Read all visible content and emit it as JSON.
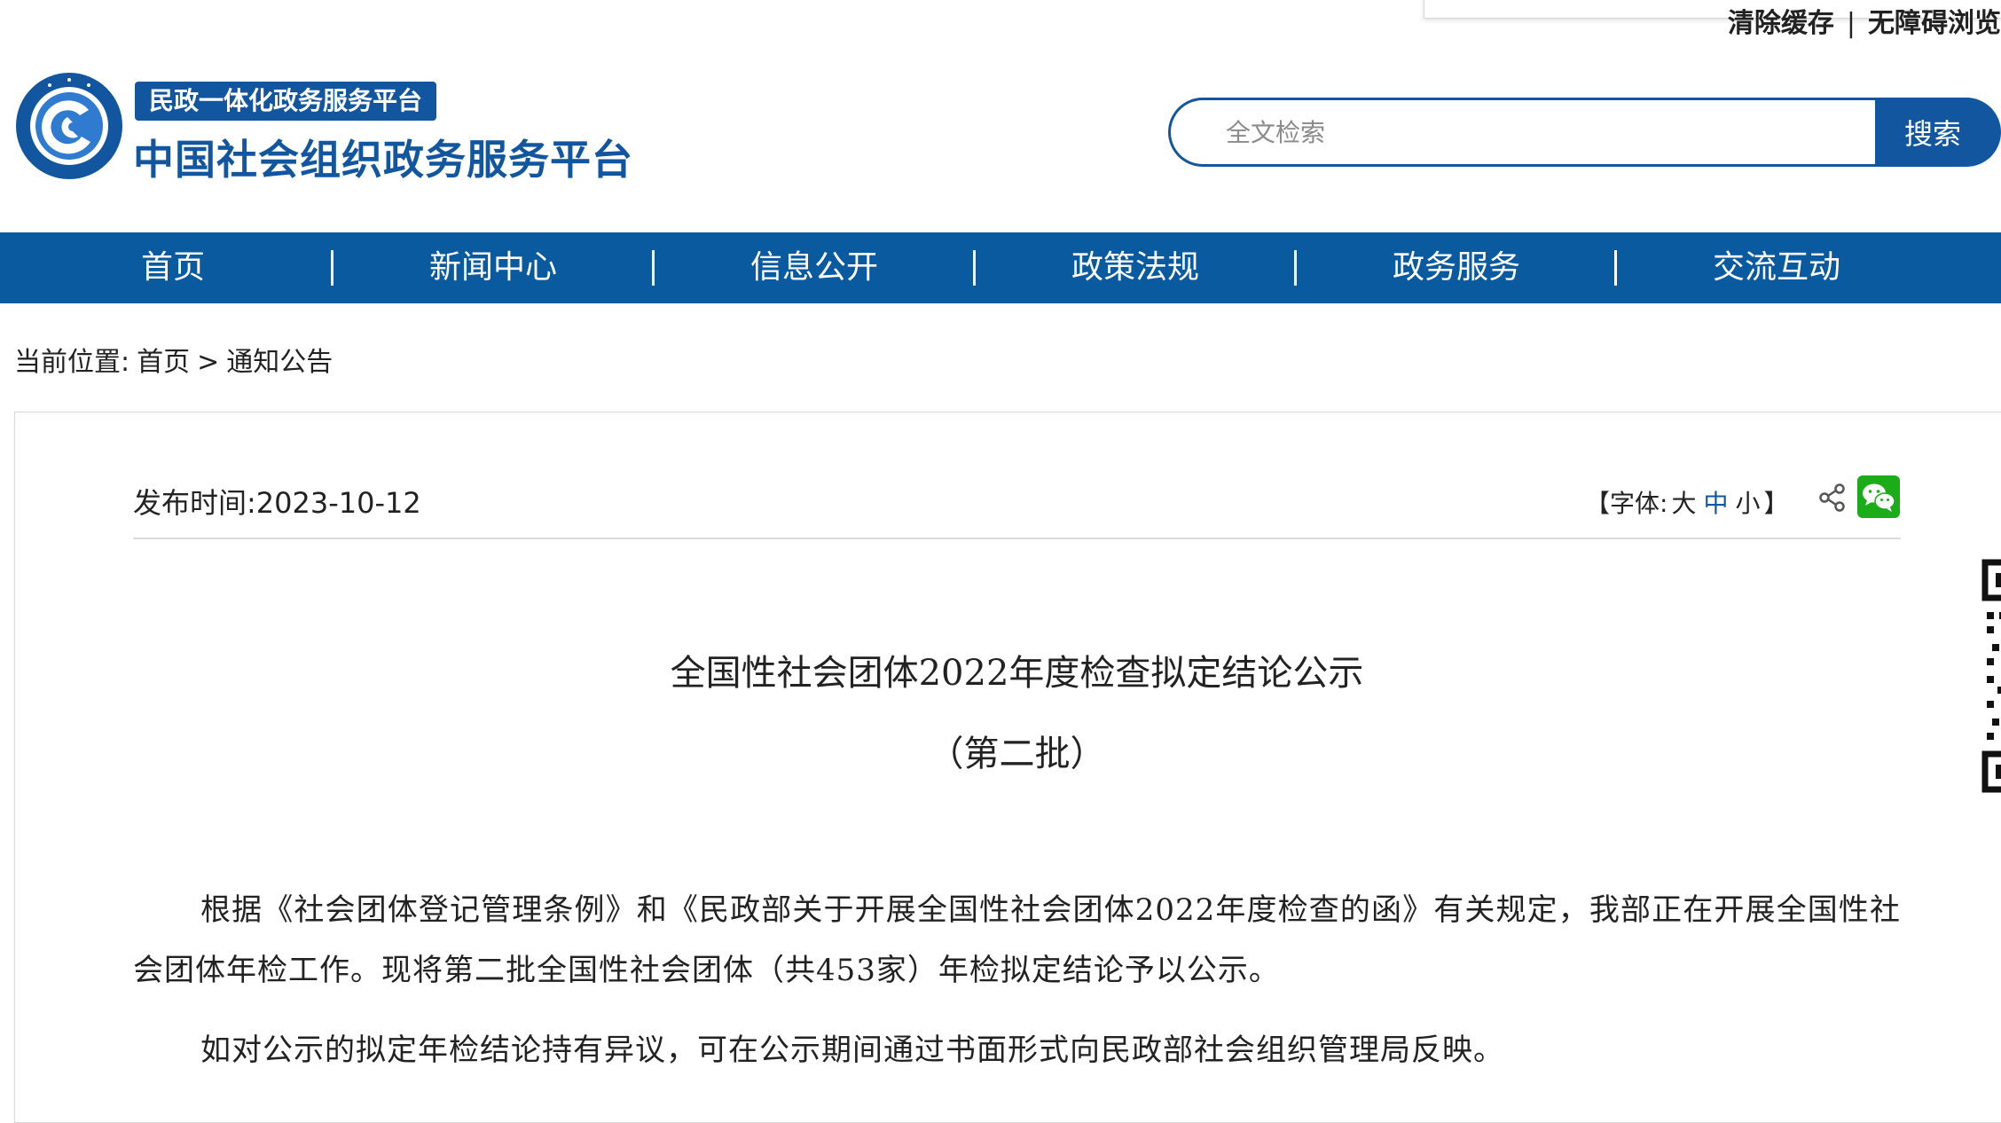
{
  "top_links": {
    "clear_cache": "清除缓存",
    "separator": "|",
    "accessibility": "无障碍浏览"
  },
  "header": {
    "platform_tag": "民政一体化政务服务平台",
    "site_title": "中国社会组织政务服务平台",
    "logo_icon": "org-emblem-icon"
  },
  "search": {
    "placeholder": "全文检索",
    "button_label": "搜索"
  },
  "nav": {
    "items": [
      {
        "label": "首页"
      },
      {
        "label": "新闻中心"
      },
      {
        "label": "信息公开"
      },
      {
        "label": "政策法规"
      },
      {
        "label": "政务服务"
      },
      {
        "label": "交流互动"
      }
    ],
    "separator": "|"
  },
  "breadcrumb": {
    "prefix": "当前位置:",
    "home": "首页",
    "arrow": ">",
    "current": "通知公告"
  },
  "article": {
    "publish_label": "发布时间:",
    "publish_date": "2023-10-12",
    "font_control": {
      "open": "【字体:",
      "large": "大",
      "medium": "中",
      "small": "小",
      "close": "】"
    },
    "title": "全国性社会团体2022年度检查拟定结论公示",
    "subtitle": "（第二批）",
    "paragraphs": [
      "根据《社会团体登记管理条例》和《民政部关于开展全国性社会团体2022年度检查的函》有关规定，我部正在开展全国性社会团体年检工作。现将第二批全国性社会团体（共453家）年检拟定结论予以公示。",
      "如对公示的拟定年检结论持有异议，可在公示期间通过书面形式向民政部社会组织管理局反映。"
    ]
  },
  "colors": {
    "brand_blue": "#1356a0",
    "nav_blue": "#0a5aa0",
    "wechat_green": "#1aad19"
  }
}
